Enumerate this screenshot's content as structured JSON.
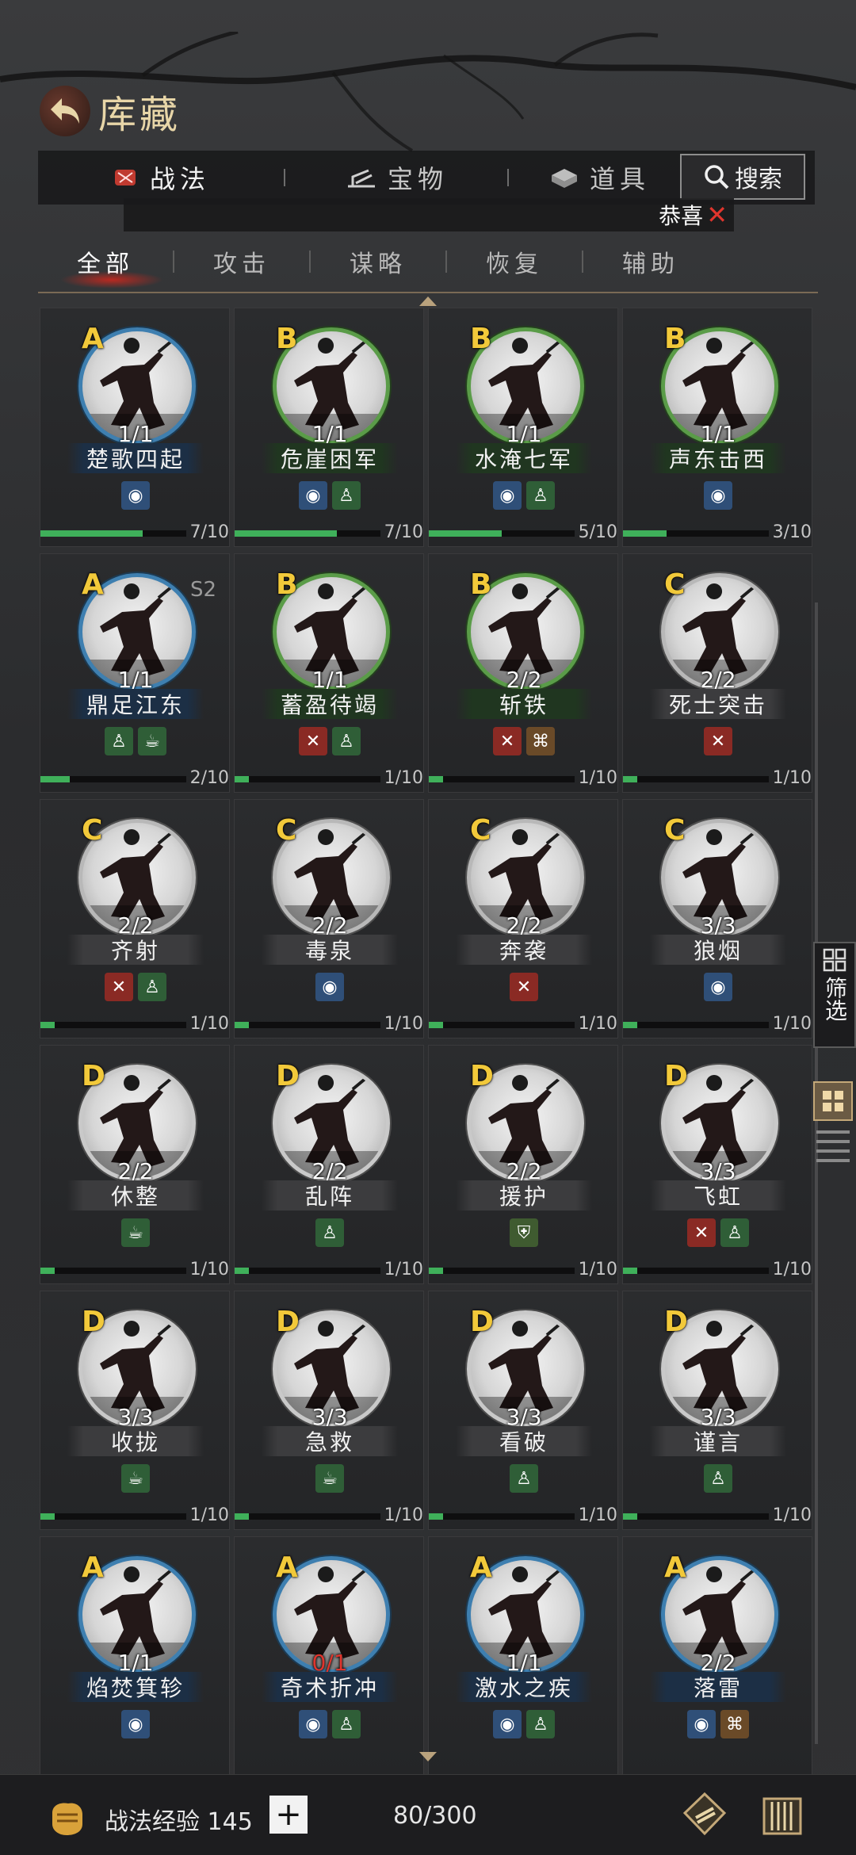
{
  "header": {
    "title": "库藏"
  },
  "top_tabs": [
    {
      "label": "战法",
      "icon": "scroll-icon"
    },
    {
      "label": "宝物",
      "icon": "weapon-icon"
    },
    {
      "label": "道具",
      "icon": "item-box-icon"
    }
  ],
  "search": {
    "label": "搜索"
  },
  "notice": {
    "text": "恭喜"
  },
  "sub_tabs": [
    "全部",
    "攻击",
    "谋略",
    "恢复",
    "辅助"
  ],
  "side": {
    "filter_label": "筛选"
  },
  "cards": [
    {
      "grade": "A",
      "count": "1/1",
      "name": "楚歌四起",
      "tags": [
        "strategy"
      ],
      "progress": "7/10",
      "fill": 0.7
    },
    {
      "grade": "B",
      "count": "1/1",
      "name": "危崖困军",
      "tags": [
        "strategy",
        "recover"
      ],
      "progress": "7/10",
      "fill": 0.7
    },
    {
      "grade": "B",
      "count": "1/1",
      "name": "水淹七军",
      "tags": [
        "strategy",
        "recover"
      ],
      "progress": "5/10",
      "fill": 0.5
    },
    {
      "grade": "B",
      "count": "1/1",
      "name": "声东击西",
      "tags": [
        "strategy"
      ],
      "progress": "3/10",
      "fill": 0.3
    },
    {
      "grade": "A",
      "count": "1/1",
      "name": "鼎足江东",
      "tags": [
        "recover",
        "support"
      ],
      "progress": "2/10",
      "fill": 0.2,
      "season": "S2"
    },
    {
      "grade": "B",
      "count": "1/1",
      "name": "蓄盈待竭",
      "tags": [
        "attack",
        "recover"
      ],
      "progress": "1/10",
      "fill": 0.1
    },
    {
      "grade": "B",
      "count": "2/2",
      "name": "斩铁",
      "tags": [
        "attack",
        "control"
      ],
      "progress": "1/10",
      "fill": 0.1
    },
    {
      "grade": "C",
      "count": "2/2",
      "name": "死士突击",
      "tags": [
        "attack"
      ],
      "progress": "1/10",
      "fill": 0.1
    },
    {
      "grade": "C",
      "count": "2/2",
      "name": "齐射",
      "tags": [
        "attack",
        "recover"
      ],
      "progress": "1/10",
      "fill": 0.1
    },
    {
      "grade": "C",
      "count": "2/2",
      "name": "毒泉",
      "tags": [
        "strategy"
      ],
      "progress": "1/10",
      "fill": 0.1
    },
    {
      "grade": "C",
      "count": "2/2",
      "name": "奔袭",
      "tags": [
        "attack"
      ],
      "progress": "1/10",
      "fill": 0.1
    },
    {
      "grade": "C",
      "count": "3/3",
      "name": "狼烟",
      "tags": [
        "strategy"
      ],
      "progress": "1/10",
      "fill": 0.1
    },
    {
      "grade": "D",
      "count": "2/2",
      "name": "休整",
      "tags": [
        "support"
      ],
      "progress": "1/10",
      "fill": 0.1
    },
    {
      "grade": "D",
      "count": "2/2",
      "name": "乱阵",
      "tags": [
        "recover"
      ],
      "progress": "1/10",
      "fill": 0.1
    },
    {
      "grade": "D",
      "count": "2/2",
      "name": "援护",
      "tags": [
        "defense"
      ],
      "progress": "1/10",
      "fill": 0.1
    },
    {
      "grade": "D",
      "count": "3/3",
      "name": "飞虹",
      "tags": [
        "attack",
        "recover"
      ],
      "progress": "1/10",
      "fill": 0.1
    },
    {
      "grade": "D",
      "count": "3/3",
      "name": "收拢",
      "tags": [
        "support"
      ],
      "progress": "1/10",
      "fill": 0.1
    },
    {
      "grade": "D",
      "count": "3/3",
      "name": "急救",
      "tags": [
        "support"
      ],
      "progress": "1/10",
      "fill": 0.1
    },
    {
      "grade": "D",
      "count": "3/3",
      "name": "看破",
      "tags": [
        "recover"
      ],
      "progress": "1/10",
      "fill": 0.1
    },
    {
      "grade": "D",
      "count": "3/3",
      "name": "谨言",
      "tags": [
        "recover"
      ],
      "progress": "1/10",
      "fill": 0.1
    },
    {
      "grade": "A",
      "count": "1/1",
      "name": "焰焚箕轸",
      "tags": [
        "strategy"
      ],
      "progress": "",
      "fill": 0
    },
    {
      "grade": "A",
      "count": "0/1",
      "name": "奇术折冲",
      "tags": [
        "strategy",
        "recover"
      ],
      "progress": "",
      "fill": 0
    },
    {
      "grade": "A",
      "count": "1/1",
      "name": "激水之疾",
      "tags": [
        "strategy",
        "recover"
      ],
      "progress": "",
      "fill": 0
    },
    {
      "grade": "A",
      "count": "2/2",
      "name": "落雷",
      "tags": [
        "strategy",
        "control"
      ],
      "progress": "",
      "fill": 0
    }
  ],
  "bottom": {
    "exp_label": "战法经验 145",
    "add_label": "+",
    "capacity": "80/300"
  },
  "colors": {
    "grade_text": "#f2c93a",
    "progress_fill": "#3fb05a",
    "zero_count": "#e0352d",
    "title_gold": "#e8d6a8"
  }
}
